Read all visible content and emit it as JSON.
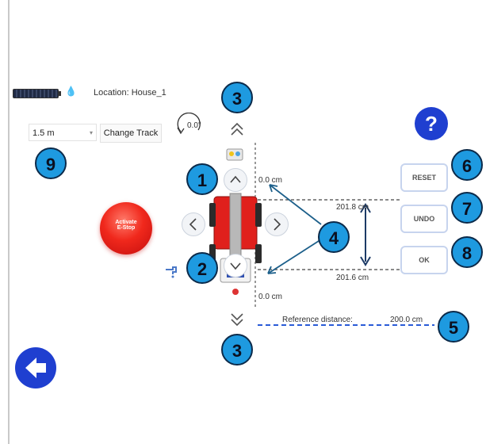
{
  "status": {
    "location_label": "Location: House_1",
    "battery_icon": "battery-icon",
    "water_icon": "water-drop-icon"
  },
  "track": {
    "selected": "1.5 m",
    "change_label": "Change Track"
  },
  "rotation": {
    "label": "0.0°"
  },
  "estop": {
    "line1": "Activate",
    "line2": "E-Stop"
  },
  "measurements": {
    "top_offset": "0.0 cm",
    "bottom_offset": "0.0 cm",
    "upper_distance": "201.8 cm",
    "lower_distance": "201.6 cm",
    "reference_label": "Reference distance:",
    "reference_value": "200.0 cm"
  },
  "actions": {
    "reset": "RESET",
    "undo": "UNDO",
    "ok": "OK"
  },
  "help": {
    "label": "?"
  },
  "callouts": [
    "1",
    "2",
    "3",
    "3",
    "4",
    "5",
    "6",
    "7",
    "8",
    "9"
  ],
  "colors": {
    "accent_blue": "#1f3fd0",
    "callout_blue": "#1e9ae0",
    "robot_red": "#e0201c",
    "dashed_line": "#2a5bd7"
  }
}
